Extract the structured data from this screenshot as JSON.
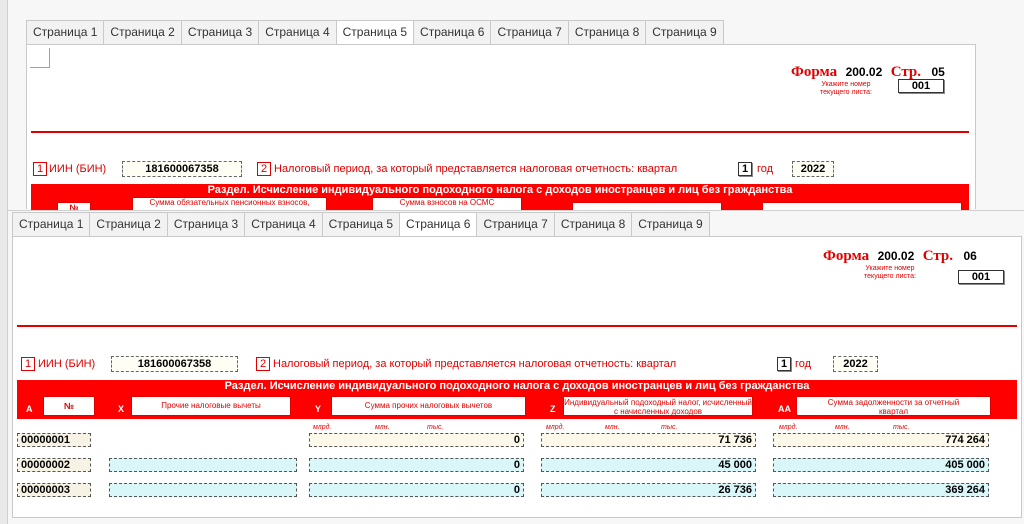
{
  "back_page": {
    "tabs": [
      "Страница 1",
      "Страница 2",
      "Страница 3",
      "Страница 4",
      "Страница 5",
      "Страница 6",
      "Страница 7",
      "Страница 8",
      "Страница 9"
    ],
    "active_tab": 4,
    "forma_word": "Форма",
    "forma_code": "200.02",
    "str_word": "Стр.",
    "page_num": "05",
    "sheet_hint": "Укажите номер текущего листа:",
    "sheet_value": "001",
    "iin_num": "1",
    "iin_label": "ИИН (БИН)",
    "iin_value": "181600067358",
    "period_num": "2",
    "period_label": "Налоговый период, за который представляется налоговая отчетность: квартал",
    "quarter": "1",
    "year_label": "год",
    "year": "2022",
    "section_title": "Раздел. Исчисление индивидуального подоходного налога с доходов иностранцев и лиц без гражданства",
    "col_a_hint": "№",
    "col_b_hint": "Сумма обязательных пенсионных взносов,",
    "col_c_hint": "Сумма взносов на ОСМС"
  },
  "front_page": {
    "tabs": [
      "Страница 1",
      "Страница 2",
      "Страница 3",
      "Страница 4",
      "Страница 5",
      "Страница 6",
      "Страница 7",
      "Страница 8",
      "Страница 9"
    ],
    "active_tab": 5,
    "forma_word": "Форма",
    "forma_code": "200.02",
    "str_word": "Стр.",
    "page_num": "06",
    "sheet_hint": "Укажите номер текущего листа:",
    "sheet_value": "001",
    "iin_num": "1",
    "iin_label": "ИИН (БИН)",
    "iin_value": "181600067358",
    "period_num": "2",
    "period_label": "Налоговый период, за который представляется налоговая отчетность: квартал",
    "quarter": "1",
    "year_label": "год",
    "year": "2022",
    "section_title": "Раздел. Исчисление индивидуального подоходного налога с доходов иностранцев и лиц без гражданства",
    "columns": [
      {
        "letter": "A",
        "label": "№"
      },
      {
        "letter": "X",
        "label": "Прочие налоговые вычеты"
      },
      {
        "letter": "Y",
        "label": "Сумма прочих налоговых вычетов"
      },
      {
        "letter": "Z",
        "label": "Индивидуальный подоходный налог, исчисленный с начисленных доходов"
      },
      {
        "letter": "AA",
        "label": "Сумма задолженности за отчетный квартал"
      }
    ],
    "units": [
      "млрд.",
      "млн.",
      "тыс."
    ],
    "rows": [
      {
        "num": "00000001",
        "y": "0",
        "z": "71 736",
        "aa": "774 264"
      },
      {
        "num": "00000002",
        "y": "0",
        "z": "45 000",
        "aa": "405 000"
      },
      {
        "num": "00000003",
        "y": "0",
        "z": "26 736",
        "aa": "369 264"
      }
    ]
  },
  "colors": {
    "accent_red": "#e00000",
    "cream": "#fcf9ea",
    "cyan": "#d9f6f9"
  }
}
